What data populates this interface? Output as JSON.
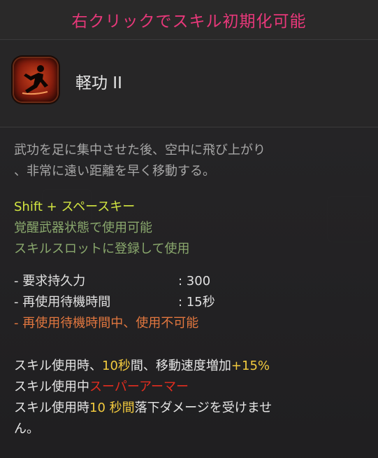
{
  "banner": {
    "text": "右クリックでスキル初期化可能"
  },
  "skill": {
    "name": "軽功 II",
    "icon": "running-figure-icon"
  },
  "description": {
    "line1": "武功を足に集中させた後、空中に飛び上がり",
    "line2": "、非常に遠い距離を早く移動する。"
  },
  "command": {
    "key": "Shift + スペースキー"
  },
  "conditions": {
    "line1": "覚醒武器状態で使用可能",
    "line2": "スキルスロットに登録して使用"
  },
  "requirements": [
    {
      "label": "- 要求持久力",
      "value": ": 300"
    },
    {
      "label": "- 再使用待機時間",
      "value": ": 15秒"
    },
    {
      "label": "- 再使用待機時間中、使用不可能"
    }
  ],
  "effects": {
    "line1_a": "スキル使用時、",
    "line1_b": "10秒",
    "line1_c": "間、移動速度増加",
    "line1_d": "+15%",
    "line2_a": "スキル使用中",
    "line2_b": "スーパーアーマー",
    "line3_a": "スキル使用時",
    "line3_b": "10 秒間",
    "line3_c": "落下ダメージを受けませ",
    "line4": "ん。"
  },
  "colors": {
    "banner": "#e8387a",
    "command": "#d3e641",
    "condition": "#8aa86d",
    "warning": "#e2773f",
    "highlight": "#f2ca3e",
    "super_armor": "#e42d1f"
  }
}
